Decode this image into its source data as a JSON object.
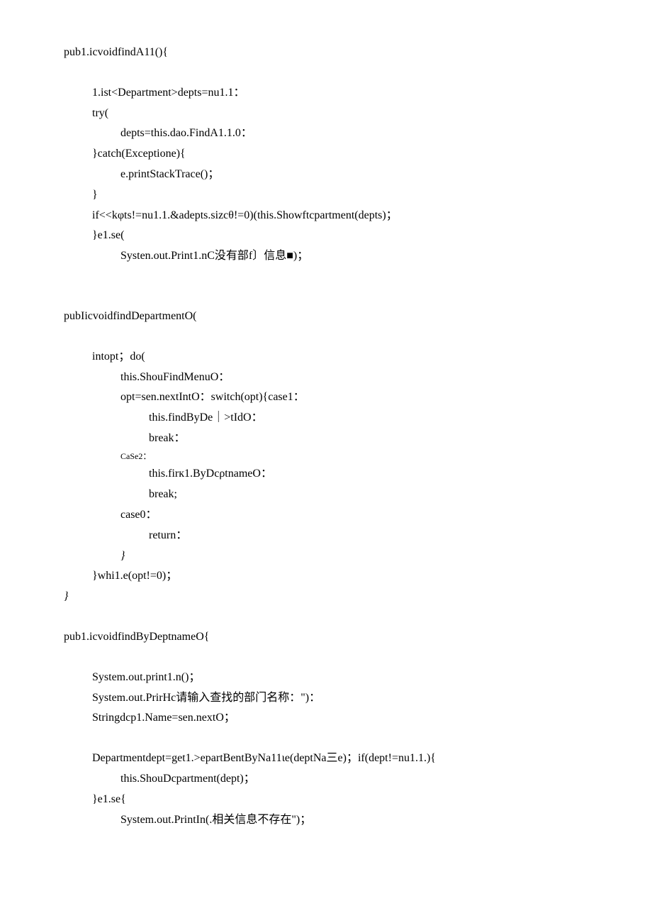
{
  "lines": {
    "l1": "pub1.icvoidfindA11(){",
    "l2": "1.ist<Department>depts=nu1.1：",
    "l3": "try(",
    "l4": "depts=this.dao.FindA1.1.0：",
    "l5": "}catch(Exceptione){",
    "l6": "e.printStackTrace()；",
    "l7": "}",
    "l8": "if<<kφts!=nu1.1.&adepts.sizcθ!=0)(this.Showftcpartment(depts)；",
    "l9": "}e1.se(",
    "l10": "Systen.out.Print1.nC没有部f〕信息■)；",
    "l11": "pubIicvoidfindDepartmentO(",
    "l12": "intopt；do(",
    "l13": "this.ShouFindMenuO：",
    "l14": "opt=sen.nextIntO：switch(opt){case1：",
    "l15": "this.findByDe｜>tIdO：",
    "l16": "break：",
    "l17": "CaSe2：",
    "l18": "this.firк1.ByDcρtnameO：",
    "l19": "break;",
    "l20": "case0：",
    "l21": "return：",
    "l22": "}",
    "l23": "}whi1.e(opt!=0)；",
    "l24": "}",
    "l25": "pub1.icvoidfindByDeptnameO{",
    "l26": "System.out.print1.n()；",
    "l27": "System.out.PrirHc请输入查找的部门名称：\")：",
    "l28": "Stringdcp1.Name=sen.nextO；",
    "l29": "Departmentdept=get1.>epartBentByNa11ιe(deptNa三e)；if(dept!=nu1.1.){",
    "l30": "this.ShouDcpartment(dept)；",
    "l31": "}e1.se{",
    "l32": "System.out.PrintIn(.相关信息不存在\")；"
  }
}
